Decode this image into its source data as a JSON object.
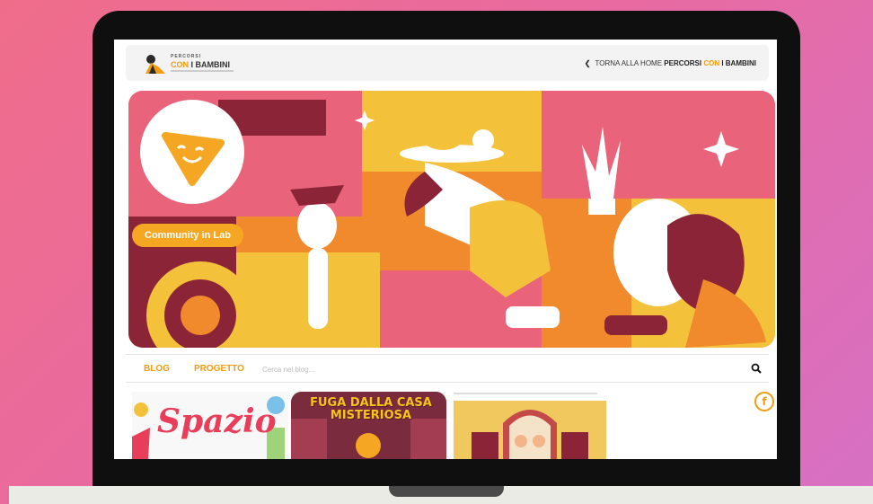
{
  "header": {
    "logo_small": "PERCORSI",
    "logo_con": "CON",
    "logo_bambini": "I BAMBINI",
    "back_prefix": "TORNA ALLA HOME",
    "back_w1": "PERCORSI",
    "back_w2": "CON",
    "back_w3": "I BAMBINI"
  },
  "hero": {
    "badge_label": "Community in Lab"
  },
  "nav": {
    "blog": "BLOG",
    "progetto": "PROGETTO",
    "search_placeholder": "Cerca nel blog..."
  },
  "cards": {
    "card1_title": "Spazio",
    "card2_title": "FUGA DALLA CASA MISTERIOSA"
  },
  "social": {
    "facebook_glyph": "f"
  },
  "colors": {
    "accent": "#f39c12",
    "hero_pink": "#e9647a",
    "hero_orange": "#f08a2c",
    "hero_yellow": "#f4c23a",
    "hero_maroon": "#8c2438"
  }
}
